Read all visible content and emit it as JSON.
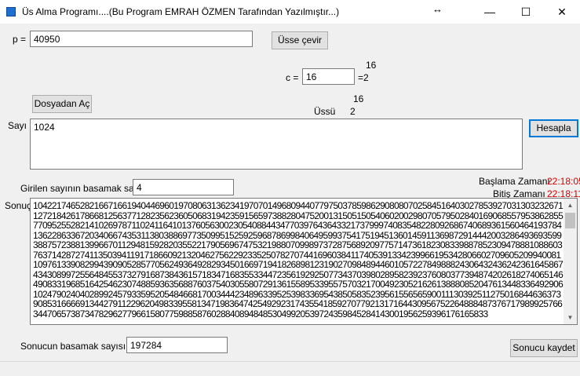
{
  "window": {
    "title": "Üs Alma Programı....(Bu Program EMRAH ÖZMEN Tarafından Yazılmıştır...)",
    "resize_glyph": "↔",
    "minimize_glyph": "—",
    "maximize_glyph": "☐",
    "close_glyph": "✕"
  },
  "p": {
    "label": "p  =",
    "value": "40950"
  },
  "usse_cevir_button": "Üsse çevir",
  "c": {
    "label": "c =",
    "value": "16",
    "eq": "=2",
    "exponent": "16"
  },
  "usu": {
    "exponent": "16",
    "label": "Üssü",
    "value": "2"
  },
  "dosyadan_ac_button": "Dosyadan Aç",
  "sayi": {
    "label": "Sayı",
    "value": "1024"
  },
  "hesapla_button": "Hesapla",
  "basamak": {
    "label": "Girilen sayının basamak sayısı",
    "value": "4"
  },
  "timing": {
    "start_label": "Başlama Zamanı",
    "start_value": "22:18:05",
    "end_label": "Bitiş Zamanı",
    "end_value": "22:18:11"
  },
  "sonuc": {
    "label": "Sonuç",
    "text": "10422174652821667166194044696019708063136234197070149680944077975037859862908080702584516403027853927031303232671127218426178668125637712823562360506831942359156597388280475200131505150540602002980705795028401690685579538628557709525528214102697871102411641013760563002305408844347703976436433217379997408354822809268674068936156046419378413622863367203406674353113803886977350995152592596878699840649599375417519451360145911369872914442003286493693599388757238813996670112948159282035522179056967475321988070998973728756892097757147361823083398878523094788810886037637142872741135039411917186609213204627562292335250782707441696038411740539133423996619534280660270960520994008110976133908299439090528577056249364928293450166971941826898123190270984894460105722784988824306432436242361645867434308997255648455373279168738436157183471683553344723561929250773437039802895823923760803773948742026182740651464908331968516425462307488593635688760375403055807291361558953395575703217004923052162613888085204761344833649290610247902404028992457933595205484668170034442348963395253983369543850583523956155656590011130392511275016844636373908531666691344279112296204983395581347198364742549292317435541859270779213171644309567522648884873767179899257663447065738734782962779661580775988587602884089484853049920539724359845284143001956259396176165833"
  },
  "sonuc_basamak": {
    "label": "Sonucun basamak sayısı",
    "value": "197284"
  },
  "sonucu_kaydet_button": "Sonucu kaydet",
  "colors": {
    "timing_value": "#d40000",
    "default_button_border": "#0078d7"
  }
}
